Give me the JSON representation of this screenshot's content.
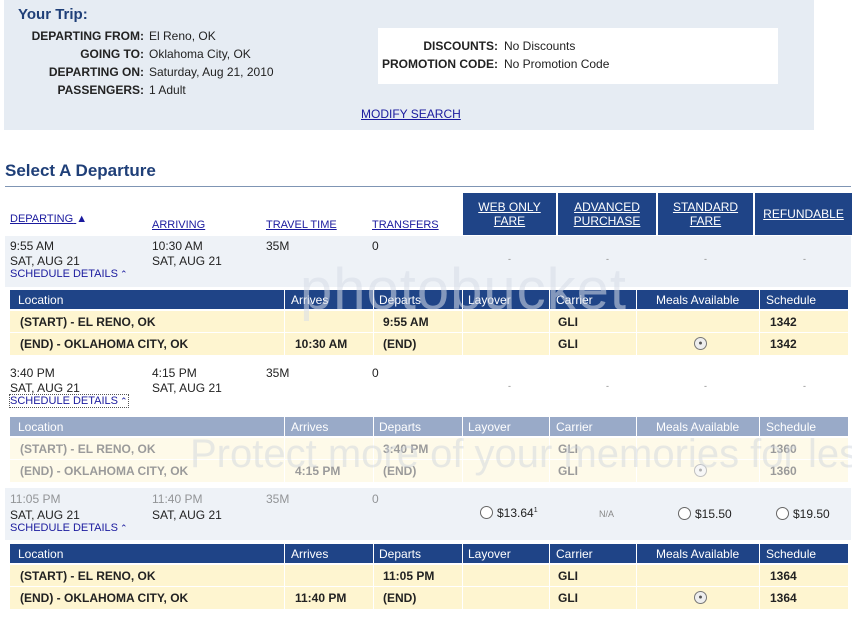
{
  "trip": {
    "title": "Your Trip:",
    "departing_from_label": "DEPARTING FROM:",
    "departing_from": "El Reno, OK",
    "going_to_label": "GOING TO:",
    "going_to": "Oklahoma City, OK",
    "departing_on_label": "DEPARTING ON:",
    "departing_on": "Saturday, Aug 21, 2010",
    "passengers_label": "PASSENGERS:",
    "passengers": "1 Adult",
    "discounts_label": "DISCOUNTS:",
    "discounts": "No Discounts",
    "promo_label": "PROMOTION CODE:",
    "promo": "No Promotion Code",
    "modify_link": "MODIFY SEARCH"
  },
  "section_title": "Select A Departure",
  "columns": {
    "departing": "DEPARTING",
    "arriving": "ARRIVING",
    "travel_time": "TRAVEL TIME",
    "transfers": "TRANSFERS",
    "web_only_1": "WEB ONLY",
    "web_only_2": "FARE",
    "advanced_1": "ADVANCED",
    "advanced_2": "PURCHASE",
    "standard_1": "STANDARD",
    "standard_2": "FARE",
    "refundable": "REFUNDABLE"
  },
  "schedule_details": "SCHEDULE DETAILS",
  "detail_headers": {
    "location": "Location",
    "arrives": "Arrives",
    "departs": "Departs",
    "layover": "Layover",
    "carrier": "Carrier",
    "meals": "Meals Available",
    "schedule": "Schedule"
  },
  "trips": [
    {
      "depart_time": "9:55 AM",
      "depart_date": "SAT, AUG 21",
      "arrive_time": "10:30 AM",
      "arrive_date": "SAT, AUG 21",
      "travel_time": "35M",
      "transfers": "0",
      "fares": [
        "-",
        "-",
        "-",
        "-"
      ],
      "stops": [
        {
          "location": "(START) - EL RENO, OK",
          "arrives": "",
          "departs": "9:55 AM",
          "carrier": "GLI",
          "schedule": "1342"
        },
        {
          "location": "(END) - OKLAHOMA CITY, OK",
          "arrives": "10:30 AM",
          "departs": "(END)",
          "carrier": "GLI",
          "schedule": "1342"
        }
      ]
    },
    {
      "depart_time": "3:40 PM",
      "depart_date": "SAT, AUG 21",
      "arrive_time": "4:15 PM",
      "arrive_date": "SAT, AUG 21",
      "travel_time": "35M",
      "transfers": "0",
      "fares": [
        "-",
        "-",
        "-",
        "-"
      ],
      "stops": [
        {
          "location": "(START) - EL RENO, OK",
          "arrives": "",
          "departs": "3:40 PM",
          "carrier": "GLI",
          "schedule": "1360"
        },
        {
          "location": "(END) - OKLAHOMA CITY, OK",
          "arrives": "4:15 PM",
          "departs": "(END)",
          "carrier": "GLI",
          "schedule": "1360"
        }
      ]
    },
    {
      "depart_time": "11:05 PM",
      "depart_date": "SAT, AUG 21",
      "arrive_time": "11:40 PM",
      "arrive_date": "SAT, AUG 21",
      "travel_time": "35M",
      "transfers": "0",
      "fares": [
        "$13.64",
        "N/A",
        "$15.50",
        "$19.50"
      ],
      "fare_footnote": "1",
      "stops": [
        {
          "location": "(START) - EL RENO, OK",
          "arrives": "",
          "departs": "11:05 PM",
          "carrier": "GLI",
          "schedule": "1364"
        },
        {
          "location": "(END) - OKLAHOMA CITY, OK",
          "arrives": "11:40 PM",
          "departs": "(END)",
          "carrier": "GLI",
          "schedule": "1364"
        }
      ]
    }
  ],
  "meal_icon": "meal-icon",
  "watermark": {
    "brand": "photobucket",
    "tagline": "Protect more of your memories for less!"
  },
  "colors": {
    "header_blue": "#1f4487",
    "title_blue": "#1f3f78",
    "row_yellow": "#fef5d0",
    "trip_bg": "#e6ecf3"
  }
}
